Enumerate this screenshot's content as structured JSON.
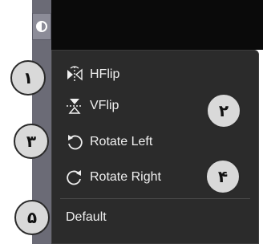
{
  "toolbar": {
    "tool_icon": "half-circle-icon"
  },
  "menu": {
    "items": [
      {
        "label": "HFlip",
        "icon": "hflip-icon"
      },
      {
        "label": "VFlip",
        "icon": "vflip-icon"
      },
      {
        "label": "Rotate Left",
        "icon": "rotate-left-icon"
      },
      {
        "label": "Rotate Right",
        "icon": "rotate-right-icon"
      },
      {
        "label": "Default"
      }
    ]
  },
  "badges": [
    "۱",
    "۲",
    "۳",
    "۴",
    "۵"
  ],
  "colors": {
    "menu_background": "#2b2b2b",
    "menu_text": "#f0f0f0",
    "badge_fill": "#d9d9d9"
  }
}
